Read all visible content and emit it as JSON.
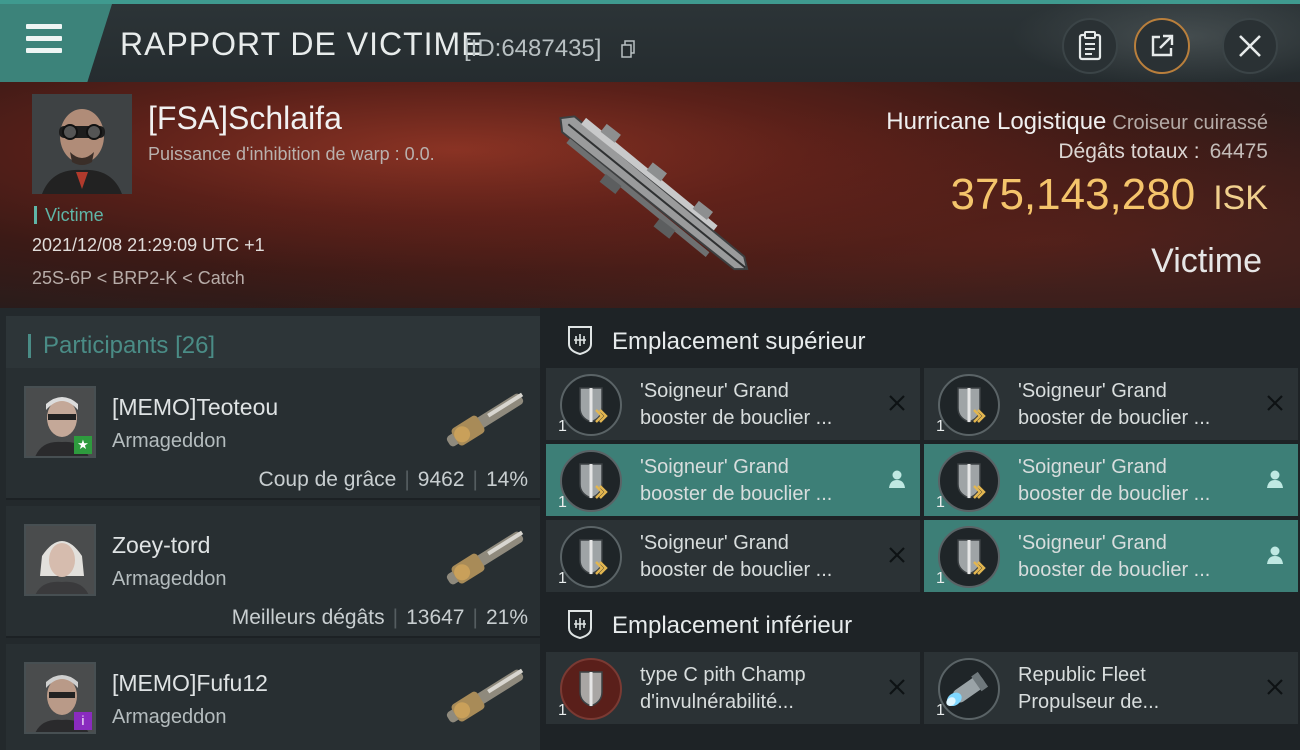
{
  "header": {
    "title": "RAPPORT DE VICTIME",
    "id_text": "[ID:6487435]"
  },
  "victim": {
    "name": "[FSA]Schlaifa",
    "warp_disruption": "Puissance d'inhibition de warp : 0.0.",
    "role": "Victime",
    "timestamp": "2021/12/08 21:29:09 UTC +1",
    "location": "25S-6P < BRP2-K < Catch",
    "ship_name": "Hurricane Logistique",
    "ship_class": "Croiseur cuirassé",
    "damage_label": "Dégâts totaux :",
    "damage_value": "64475",
    "isk_value": "375,143,280",
    "isk_unit": "ISK",
    "tag": "Victime"
  },
  "participants": {
    "label": "Participants",
    "count": "[26]",
    "rows": [
      {
        "name": "[MEMO]Teoteou",
        "ship": "Armageddon",
        "stat_label": "Coup de grâce",
        "damage": "9462",
        "percent": "14%",
        "badge": "★",
        "badge_color": "#2e9b3e"
      },
      {
        "name": "Zoey-tord",
        "ship": "Armageddon",
        "stat_label": "Meilleurs dégâts",
        "damage": "13647",
        "percent": "21%",
        "badge": "",
        "badge_color": ""
      },
      {
        "name": "[MEMO]Fufu12",
        "ship": "Armageddon",
        "stat_label": "",
        "damage": "",
        "percent": "",
        "badge": "i",
        "badge_color": "#8a2bbf"
      }
    ]
  },
  "modules": {
    "high_title": "Emplacement supérieur",
    "low_title": "Emplacement inférieur",
    "high": [
      {
        "line1": "'Soigneur'  Grand",
        "line2": "booster de bouclier ...",
        "qty": "1",
        "state": "destroyed"
      },
      {
        "line1": "'Soigneur'  Grand",
        "line2": "booster de bouclier ...",
        "qty": "1",
        "state": "destroyed"
      },
      {
        "line1": "'Soigneur'  Grand",
        "line2": "booster de bouclier ...",
        "qty": "1",
        "state": "dropped"
      },
      {
        "line1": "'Soigneur'  Grand",
        "line2": "booster de bouclier ...",
        "qty": "1",
        "state": "dropped"
      },
      {
        "line1": "'Soigneur'  Grand",
        "line2": "booster de bouclier ...",
        "qty": "1",
        "state": "destroyed"
      },
      {
        "line1": "'Soigneur'  Grand",
        "line2": "booster de bouclier ...",
        "qty": "1",
        "state": "dropped"
      }
    ],
    "low": [
      {
        "line1": "type C pith Champ",
        "line2": "d'invulnérabilité...",
        "qty": "1",
        "state": "destroyed",
        "icon": "invulnerability-field-icon"
      },
      {
        "line1": "Republic Fleet",
        "line2": "Propulseur de...",
        "qty": "1",
        "state": "destroyed",
        "icon": "propulsion-module-icon"
      }
    ]
  }
}
